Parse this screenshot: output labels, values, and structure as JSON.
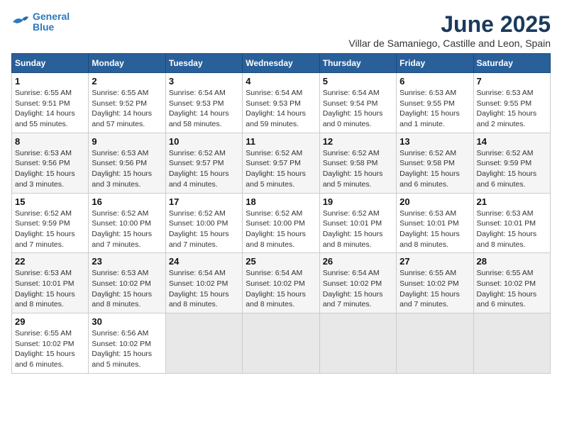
{
  "logo": {
    "line1": "General",
    "line2": "Blue"
  },
  "title": "June 2025",
  "subtitle": "Villar de Samaniego, Castille and Leon, Spain",
  "days_header": [
    "Sunday",
    "Monday",
    "Tuesday",
    "Wednesday",
    "Thursday",
    "Friday",
    "Saturday"
  ],
  "weeks": [
    [
      {
        "num": "1",
        "detail": "Sunrise: 6:55 AM\nSunset: 9:51 PM\nDaylight: 14 hours\nand 55 minutes."
      },
      {
        "num": "2",
        "detail": "Sunrise: 6:55 AM\nSunset: 9:52 PM\nDaylight: 14 hours\nand 57 minutes."
      },
      {
        "num": "3",
        "detail": "Sunrise: 6:54 AM\nSunset: 9:53 PM\nDaylight: 14 hours\nand 58 minutes."
      },
      {
        "num": "4",
        "detail": "Sunrise: 6:54 AM\nSunset: 9:53 PM\nDaylight: 14 hours\nand 59 minutes."
      },
      {
        "num": "5",
        "detail": "Sunrise: 6:54 AM\nSunset: 9:54 PM\nDaylight: 15 hours\nand 0 minutes."
      },
      {
        "num": "6",
        "detail": "Sunrise: 6:53 AM\nSunset: 9:55 PM\nDaylight: 15 hours\nand 1 minute."
      },
      {
        "num": "7",
        "detail": "Sunrise: 6:53 AM\nSunset: 9:55 PM\nDaylight: 15 hours\nand 2 minutes."
      }
    ],
    [
      {
        "num": "8",
        "detail": "Sunrise: 6:53 AM\nSunset: 9:56 PM\nDaylight: 15 hours\nand 3 minutes."
      },
      {
        "num": "9",
        "detail": "Sunrise: 6:53 AM\nSunset: 9:56 PM\nDaylight: 15 hours\nand 3 minutes."
      },
      {
        "num": "10",
        "detail": "Sunrise: 6:52 AM\nSunset: 9:57 PM\nDaylight: 15 hours\nand 4 minutes."
      },
      {
        "num": "11",
        "detail": "Sunrise: 6:52 AM\nSunset: 9:57 PM\nDaylight: 15 hours\nand 5 minutes."
      },
      {
        "num": "12",
        "detail": "Sunrise: 6:52 AM\nSunset: 9:58 PM\nDaylight: 15 hours\nand 5 minutes."
      },
      {
        "num": "13",
        "detail": "Sunrise: 6:52 AM\nSunset: 9:58 PM\nDaylight: 15 hours\nand 6 minutes."
      },
      {
        "num": "14",
        "detail": "Sunrise: 6:52 AM\nSunset: 9:59 PM\nDaylight: 15 hours\nand 6 minutes."
      }
    ],
    [
      {
        "num": "15",
        "detail": "Sunrise: 6:52 AM\nSunset: 9:59 PM\nDaylight: 15 hours\nand 7 minutes."
      },
      {
        "num": "16",
        "detail": "Sunrise: 6:52 AM\nSunset: 10:00 PM\nDaylight: 15 hours\nand 7 minutes."
      },
      {
        "num": "17",
        "detail": "Sunrise: 6:52 AM\nSunset: 10:00 PM\nDaylight: 15 hours\nand 7 minutes."
      },
      {
        "num": "18",
        "detail": "Sunrise: 6:52 AM\nSunset: 10:00 PM\nDaylight: 15 hours\nand 8 minutes."
      },
      {
        "num": "19",
        "detail": "Sunrise: 6:52 AM\nSunset: 10:01 PM\nDaylight: 15 hours\nand 8 minutes."
      },
      {
        "num": "20",
        "detail": "Sunrise: 6:53 AM\nSunset: 10:01 PM\nDaylight: 15 hours\nand 8 minutes."
      },
      {
        "num": "21",
        "detail": "Sunrise: 6:53 AM\nSunset: 10:01 PM\nDaylight: 15 hours\nand 8 minutes."
      }
    ],
    [
      {
        "num": "22",
        "detail": "Sunrise: 6:53 AM\nSunset: 10:01 PM\nDaylight: 15 hours\nand 8 minutes."
      },
      {
        "num": "23",
        "detail": "Sunrise: 6:53 AM\nSunset: 10:02 PM\nDaylight: 15 hours\nand 8 minutes."
      },
      {
        "num": "24",
        "detail": "Sunrise: 6:54 AM\nSunset: 10:02 PM\nDaylight: 15 hours\nand 8 minutes."
      },
      {
        "num": "25",
        "detail": "Sunrise: 6:54 AM\nSunset: 10:02 PM\nDaylight: 15 hours\nand 8 minutes."
      },
      {
        "num": "26",
        "detail": "Sunrise: 6:54 AM\nSunset: 10:02 PM\nDaylight: 15 hours\nand 7 minutes."
      },
      {
        "num": "27",
        "detail": "Sunrise: 6:55 AM\nSunset: 10:02 PM\nDaylight: 15 hours\nand 7 minutes."
      },
      {
        "num": "28",
        "detail": "Sunrise: 6:55 AM\nSunset: 10:02 PM\nDaylight: 15 hours\nand 6 minutes."
      }
    ],
    [
      {
        "num": "29",
        "detail": "Sunrise: 6:55 AM\nSunset: 10:02 PM\nDaylight: 15 hours\nand 6 minutes."
      },
      {
        "num": "30",
        "detail": "Sunrise: 6:56 AM\nSunset: 10:02 PM\nDaylight: 15 hours\nand 5 minutes."
      },
      {
        "num": "",
        "detail": ""
      },
      {
        "num": "",
        "detail": ""
      },
      {
        "num": "",
        "detail": ""
      },
      {
        "num": "",
        "detail": ""
      },
      {
        "num": "",
        "detail": ""
      }
    ]
  ]
}
